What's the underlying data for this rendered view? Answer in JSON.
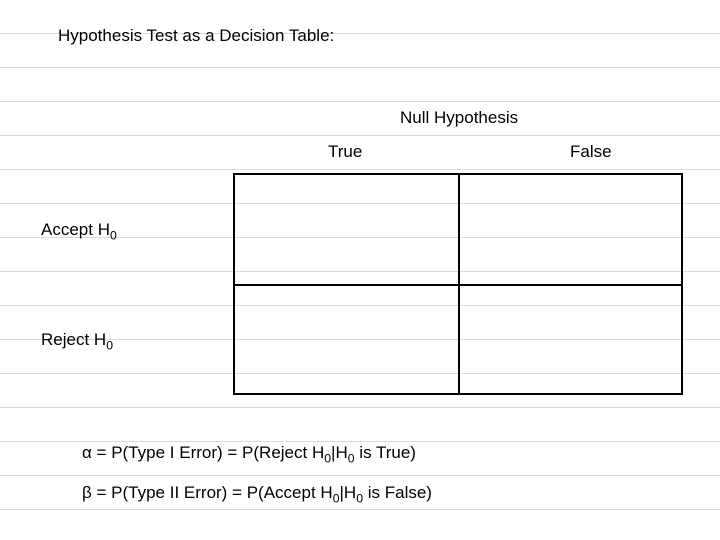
{
  "title": "Hypothesis Test as a Decision Table:",
  "columns": {
    "super": "Null Hypothesis",
    "true": "True",
    "false": "False"
  },
  "rows": {
    "accept_prefix": "Accept H",
    "accept_sub": "0",
    "reject_prefix": "Reject H",
    "reject_sub": "0"
  },
  "cells": {
    "accept_true": "",
    "accept_false": "",
    "reject_true": "",
    "reject_false": ""
  },
  "alpha": {
    "sym": "α",
    "mid1": " = P(Type I Error) = P(Reject H",
    "sub1": "0",
    "mid2": "|H",
    "sub2": "0",
    "tail": " is True)"
  },
  "beta": {
    "sym": "β",
    "mid1": " = P(Type II Error) = P(Accept H",
    "sub1": "0",
    "mid2": "|H",
    "sub2": "0",
    "tail": " is False)"
  },
  "chart_data": {
    "type": "table",
    "title": "Hypothesis Test as a Decision Table",
    "col_header_super": "Null Hypothesis",
    "columns": [
      "True",
      "False"
    ],
    "rows": [
      "Accept H0",
      "Reject H0"
    ],
    "cells": [
      [
        "",
        ""
      ],
      [
        "",
        ""
      ]
    ],
    "notes": [
      "α = P(Type I Error) = P(Reject H0 | H0 is True)",
      "β = P(Type II Error) = P(Accept H0 | H0 is False)"
    ]
  }
}
